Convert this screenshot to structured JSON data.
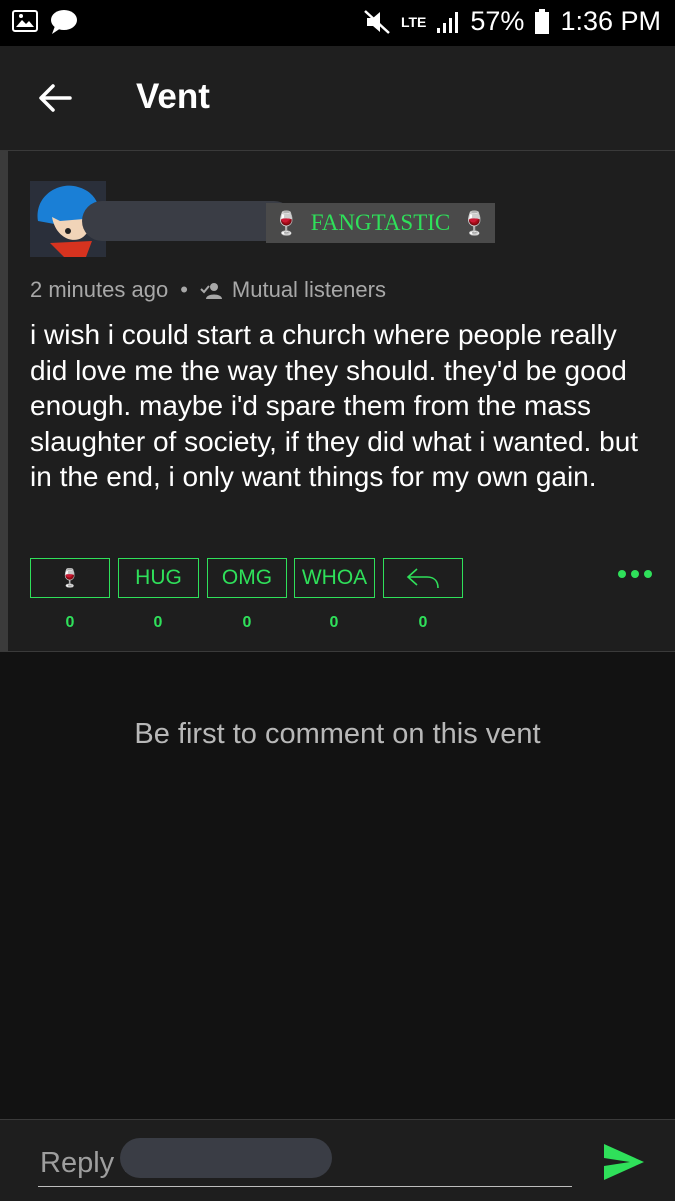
{
  "status_bar": {
    "network": "LTE",
    "battery": "57%",
    "time": "1:36 PM"
  },
  "app_bar": {
    "title": "Vent"
  },
  "post": {
    "badge": "FANGTASTIC",
    "timestamp": "2 minutes ago",
    "separator": "•",
    "audience": "Mutual listeners",
    "text": "i wish i could start a church where people really did love me the way they should. they'd be good enough. maybe i'd spare them from the mass slaughter of society, if they did what i wanted. but in the end, i only want things for my own gain.",
    "reactions": [
      {
        "label": "🍷",
        "count": "0",
        "icon": "wine-glass-icon"
      },
      {
        "label": "HUG",
        "count": "0"
      },
      {
        "label": "OMG",
        "count": "0"
      },
      {
        "label": "WHOA",
        "count": "0"
      },
      {
        "label": "",
        "count": "0",
        "icon": "reply-arrow-icon"
      }
    ]
  },
  "comments": {
    "empty_message": "Be first to comment on this vent"
  },
  "reply": {
    "placeholder": "Reply t"
  },
  "colors": {
    "accent": "#2fe05a",
    "background": "#121212",
    "card": "#1e1e1e"
  }
}
